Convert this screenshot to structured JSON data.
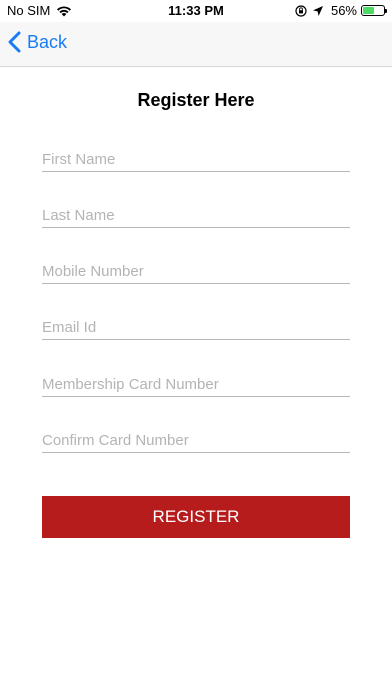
{
  "status_bar": {
    "carrier": "No SIM",
    "time": "11:33 PM",
    "battery_percent": "56%",
    "battery_level": 0.56,
    "battery_color": "#4cd964",
    "icons": [
      "wifi-icon",
      "orientation-lock-icon",
      "location-arrow-icon",
      "battery-icon"
    ]
  },
  "nav": {
    "back_label": "Back",
    "accent_color": "#1a7cf5"
  },
  "page": {
    "title": "Register Here"
  },
  "form": {
    "first_name": {
      "placeholder": "First Name",
      "value": ""
    },
    "last_name": {
      "placeholder": "Last Name",
      "value": ""
    },
    "mobile_number": {
      "placeholder": "Mobile Number",
      "value": ""
    },
    "email_id": {
      "placeholder": "Email Id",
      "value": ""
    },
    "membership_card_number": {
      "placeholder": "Membership Card Number",
      "value": ""
    },
    "confirm_card_number": {
      "placeholder": "Confirm Card Number",
      "value": ""
    },
    "register_label": "REGISTER",
    "register_color": "#b71c1c"
  }
}
